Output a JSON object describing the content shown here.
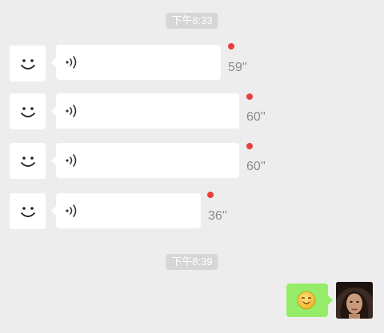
{
  "chat": {
    "timestamps": [
      "下午8:33",
      "下午8:39"
    ],
    "messages": [
      {
        "direction": "incoming",
        "type": "voice",
        "duration": "59''",
        "unread": true
      },
      {
        "direction": "incoming",
        "type": "voice",
        "duration": "60''",
        "unread": true
      },
      {
        "direction": "incoming",
        "type": "voice",
        "duration": "60''",
        "unread": true
      },
      {
        "direction": "incoming",
        "type": "voice",
        "duration": "36''",
        "unread": true
      },
      {
        "direction": "outgoing",
        "type": "emoji",
        "emoji": "smiling-face-icon"
      }
    ]
  },
  "icons": {
    "contact_avatar": "smiley-face-icon",
    "voice": "voice-wave-icon",
    "unread": "red-dot-icon",
    "user_avatar": "user-photo-avatar"
  },
  "colors": {
    "background": "#ededed",
    "incoming_bubble": "#ffffff",
    "outgoing_bubble": "#95ec69",
    "unread_dot": "#e5413c",
    "timestamp_bg": "#d6d6d6"
  }
}
